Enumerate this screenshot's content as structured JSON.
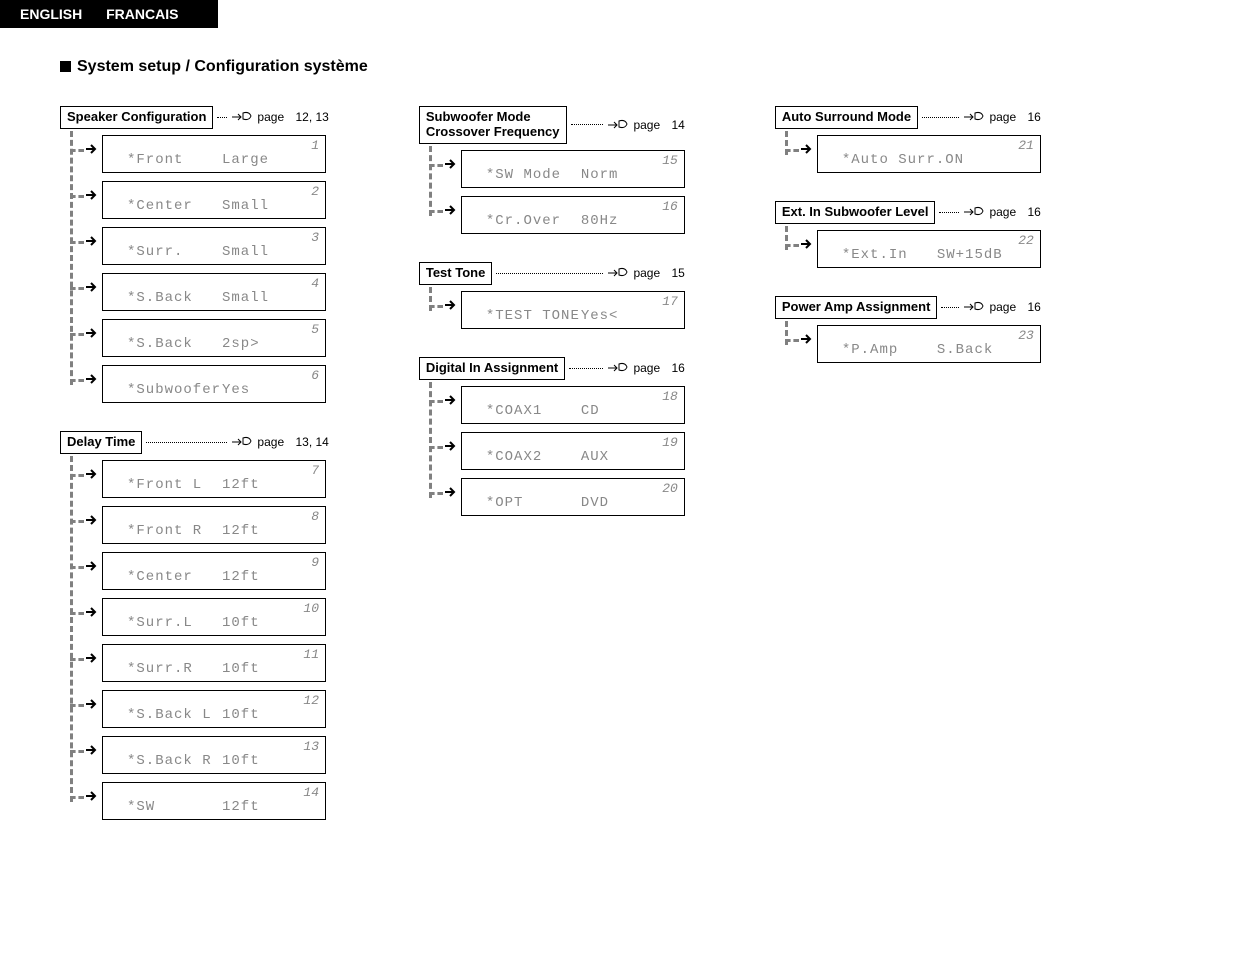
{
  "lang": {
    "en": "ENGLISH",
    "fr": "FRANCAIS"
  },
  "heading": "System setup / Configuration système",
  "page_word": "page",
  "blocks": {
    "speaker": {
      "title": "Speaker Configuration",
      "page": "12, 13",
      "items": [
        {
          "n": "1",
          "label": "*Front",
          "val": "Large"
        },
        {
          "n": "2",
          "label": "*Center",
          "val": "Small"
        },
        {
          "n": "3",
          "label": "*Surr.",
          "val": "Small"
        },
        {
          "n": "4",
          "label": "*S.Back",
          "val": "Small"
        },
        {
          "n": "5",
          "label": "*S.Back",
          "val": "2sp>"
        },
        {
          "n": "6",
          "label": "*Subwoofer",
          "val": "Yes"
        }
      ]
    },
    "delay": {
      "title": "Delay Time",
      "page": "13, 14",
      "items": [
        {
          "n": "7",
          "label": "*Front L",
          "val": "12ft"
        },
        {
          "n": "8",
          "label": "*Front R",
          "val": "12ft"
        },
        {
          "n": "9",
          "label": "*Center",
          "val": "12ft"
        },
        {
          "n": "10",
          "label": "*Surr.L",
          "val": "10ft"
        },
        {
          "n": "11",
          "label": "*Surr.R",
          "val": "10ft"
        },
        {
          "n": "12",
          "label": "*S.Back L",
          "val": "10ft"
        },
        {
          "n": "13",
          "label": "*S.Back R",
          "val": "10ft"
        },
        {
          "n": "14",
          "label": "*SW",
          "val": "12ft"
        }
      ]
    },
    "subwoofer": {
      "title_l1": "Subwoofer Mode",
      "title_l2": "Crossover Frequency",
      "page": "14",
      "items": [
        {
          "n": "15",
          "label": "*SW Mode",
          "val": "Norm"
        },
        {
          "n": "16",
          "label": "*Cr.Over",
          "val": "80Hz"
        }
      ]
    },
    "testtone": {
      "title": "Test Tone",
      "page": "15",
      "items": [
        {
          "n": "17",
          "label": "*TEST TONE",
          "val": "Yes<"
        }
      ]
    },
    "digital": {
      "title": "Digital In Assignment",
      "page": "16",
      "items": [
        {
          "n": "18",
          "label": "*COAX1",
          "val": "CD"
        },
        {
          "n": "19",
          "label": "*COAX2",
          "val": "AUX"
        },
        {
          "n": "20",
          "label": "*OPT",
          "val": "DVD"
        }
      ]
    },
    "auto": {
      "title": "Auto Surround Mode",
      "page": "16",
      "items": [
        {
          "n": "21",
          "label": "*Auto Surr.",
          "val": "ON"
        }
      ]
    },
    "ext": {
      "title": "Ext. In Subwoofer Level",
      "page": "16",
      "items": [
        {
          "n": "22",
          "label": "*Ext.In",
          "val": "SW+15dB"
        }
      ]
    },
    "power": {
      "title": "Power Amp Assignment",
      "page": "16",
      "items": [
        {
          "n": "23",
          "label": "*P.Amp",
          "val": "S.Back"
        }
      ]
    }
  }
}
